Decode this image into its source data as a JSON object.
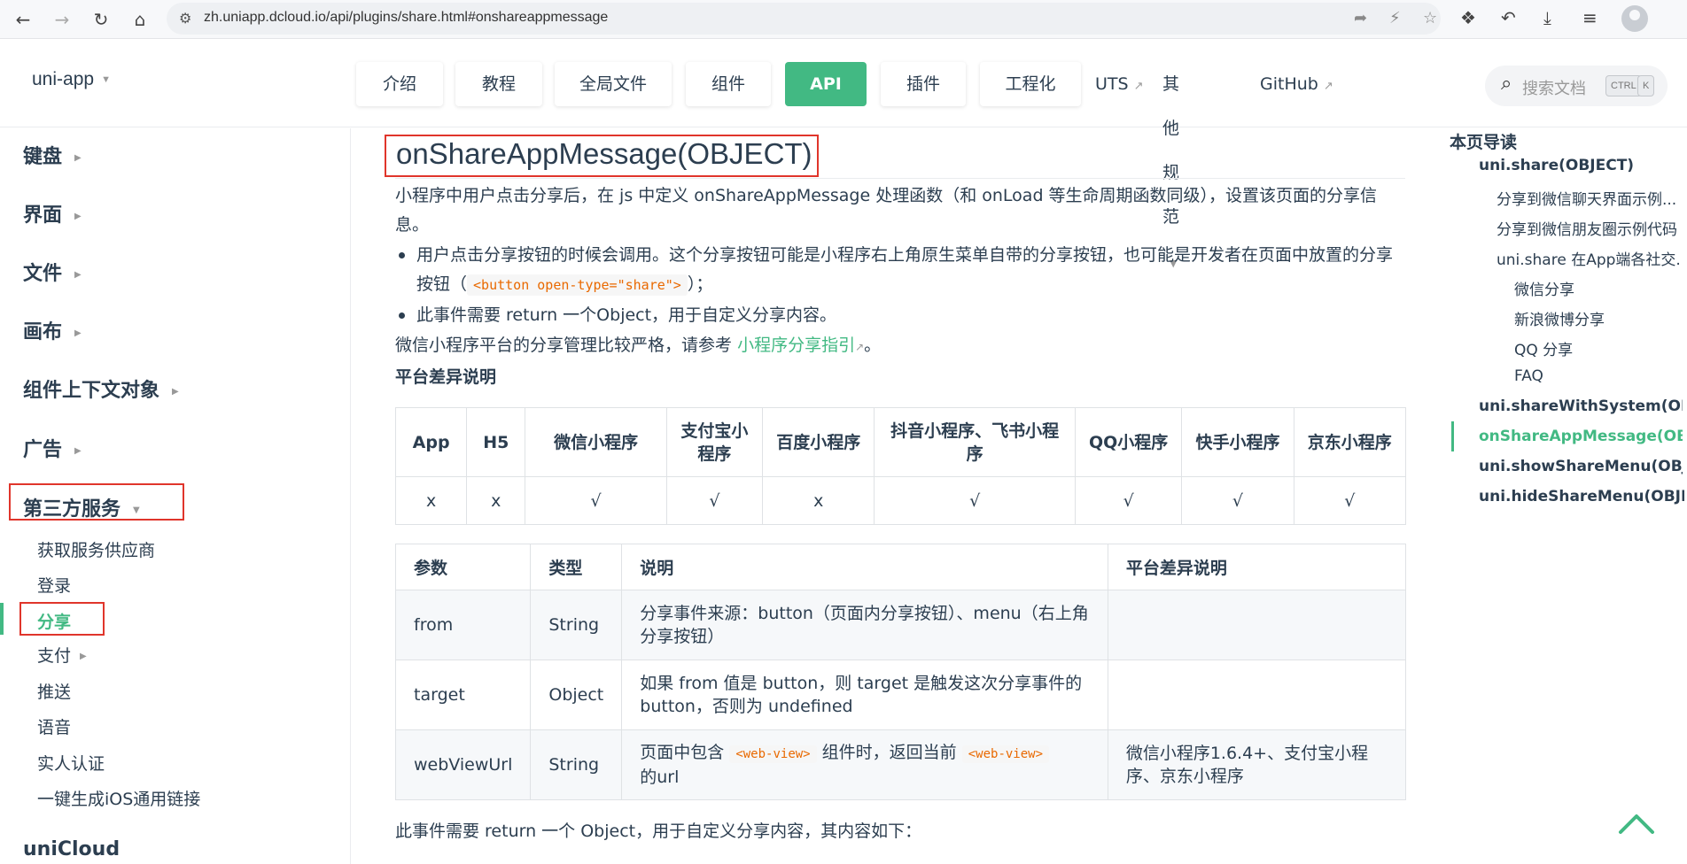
{
  "browser": {
    "url": "zh.uniapp.dcloud.io/api/plugins/share.html#onshareappmessage",
    "nav_icons": [
      "back-arrow",
      "forward-arrow",
      "reload",
      "home"
    ]
  },
  "header": {
    "brand": "uni-app",
    "nav": [
      {
        "label": "介绍",
        "active": false
      },
      {
        "label": "教程",
        "active": false
      },
      {
        "label": "全局文件",
        "active": false
      },
      {
        "label": "组件",
        "active": false
      },
      {
        "label": "API",
        "active": true
      },
      {
        "label": "插件",
        "active": false
      },
      {
        "label": "工程化",
        "active": false
      }
    ],
    "links": [
      {
        "label": "UTS",
        "external": true
      },
      {
        "label": "其他规范",
        "dropdown": true
      },
      {
        "label": "GitHub",
        "external": true
      }
    ],
    "search": {
      "placeholder": "搜索文档",
      "key1": "CTRL",
      "key2": "K"
    }
  },
  "sidebar": {
    "groups": [
      "键盘",
      "界面",
      "文件",
      "画布",
      "组件上下文对象",
      "广告",
      "第三方服务"
    ],
    "items": [
      {
        "label": "获取服务供应商"
      },
      {
        "label": "登录"
      },
      {
        "label": "分享",
        "active": true
      },
      {
        "label": "支付"
      },
      {
        "label": "推送"
      },
      {
        "label": "语音"
      },
      {
        "label": "实人认证"
      },
      {
        "label": "一键生成iOS通用链接"
      }
    ],
    "bottom_group": "uniCloud"
  },
  "content": {
    "title": "onShareAppMessage(OBJECT)",
    "intro": "小程序中用户点击分享后，在 js 中定义 onShareAppMessage 处理函数（和 onLoad 等生命周期函数同级），设置该页面的分享信息。",
    "bullet1_pre": "用户点击分享按钮的时候会调用。这个分享按钮可能是小程序右上角原生菜单自带的分享按钮，也可能是开发者在页面中放置的分享按钮（",
    "bullet1_code": "<button open-type=\"share\">",
    "bullet1_post": "）；",
    "bullet2": "此事件需要 return 一个Object，用于自定义分享内容。",
    "wx_note_pre": "微信小程序平台的分享管理比较严格，请参考",
    "wx_note_link": "小程序分享指引",
    "wx_note_post": "。",
    "platform_heading": "平台差异说明",
    "platform_table": {
      "headers": [
        "App",
        "H5",
        "微信小程序",
        "支付宝小程序",
        "百度小程序",
        "抖音小程序、飞书小程序",
        "QQ小程序",
        "快手小程序",
        "京东小程序"
      ],
      "row": [
        "x",
        "x",
        "√",
        "√",
        "x",
        "√",
        "√",
        "√",
        "√"
      ]
    },
    "param_table": {
      "headers": [
        "参数",
        "类型",
        "说明",
        "平台差异说明"
      ],
      "rows": [
        {
          "param": "from",
          "type": "String",
          "desc": "分享事件来源：button（页面内分享按钮）、menu（右上角分享按钮）",
          "platform": ""
        },
        {
          "param": "target",
          "type": "Object",
          "desc": "如果 from 值是 button，则 target 是触发这次分享事件的 button，否则为 undefined",
          "platform": ""
        },
        {
          "param": "webViewUrl",
          "type": "String",
          "desc_pre": "页面中包含",
          "desc_code1": "<web-view>",
          "desc_mid": "组件时，返回当前",
          "desc_code2": "<web-view>",
          "desc_post": "的url",
          "platform": "微信小程序1.6.4+、支付宝小程序、京东小程序"
        }
      ]
    },
    "after_table": "此事件需要 return 一个 Object，用于自定义分享内容，其内容如下："
  },
  "toc": {
    "title": "本页导读",
    "items": [
      {
        "label": "uni.share(OBJECT)",
        "level": 1
      },
      {
        "label": "分享到微信聊天界面示例...",
        "level": 2
      },
      {
        "label": "分享到微信朋友圈示例代码",
        "level": 2
      },
      {
        "label": "uni.share 在App端各社交...",
        "level": 2
      },
      {
        "label": "微信分享",
        "level": 3
      },
      {
        "label": "新浪微博分享",
        "level": 3
      },
      {
        "label": "QQ 分享",
        "level": 3
      },
      {
        "label": "FAQ",
        "level": 3
      },
      {
        "label": "uni.shareWithSystem(OBJ...",
        "level": 1
      },
      {
        "label": "onShareAppMessage(OBJ...",
        "level": 1,
        "active": true
      },
      {
        "label": "uni.showShareMenu(OBJE...",
        "level": 1
      },
      {
        "label": "uni.hideShareMenu(OBJECT)",
        "level": 1
      }
    ]
  },
  "colors": {
    "accent": "#42b983",
    "highlight_box": "#e0352b",
    "code": "#e96900",
    "text": "#2c3e50"
  }
}
